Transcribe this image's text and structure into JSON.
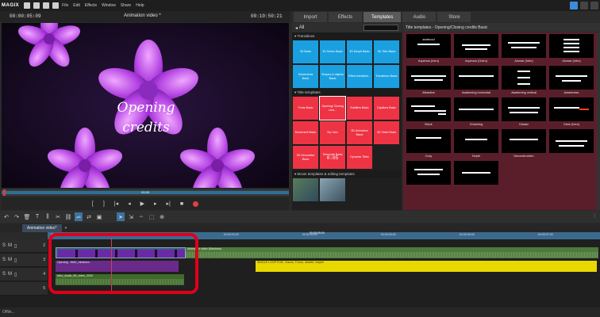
{
  "app": {
    "logo": "MAGIX",
    "menu": [
      "File",
      "Edit",
      "Effects",
      "Window",
      "Share",
      "Help"
    ]
  },
  "preview": {
    "timecode_left": "00:00:05:09",
    "title": "Animation video *",
    "timecode_right": "00:10:50:21",
    "overlay_line1": "Opening",
    "overlay_line2": "credits",
    "scrub_label": "00:05",
    "scrub_progress": 0.01
  },
  "tabs": [
    "Import",
    "Effects",
    "Templates",
    "Audio",
    "Store"
  ],
  "active_tab": "Templates",
  "catalog": {
    "filter_label": "All",
    "sections": [
      {
        "title": "Transitions",
        "tiles": [
          {
            "label": "3D Basic",
            "color": "blue"
          },
          {
            "label": "3D Series Basic",
            "color": "blue"
          },
          {
            "label": "3D Morph Basic",
            "color": "blue"
          },
          {
            "label": "3D Tiles Basic",
            "color": "blue"
          },
          {
            "label": "Movements Basic",
            "color": "blue"
          },
          {
            "label": "Shapes & objects Basic",
            "color": "blue"
          },
          {
            "label": "Effect transition...",
            "color": "blue"
          },
          {
            "label": "Transitions Basic",
            "color": "blue"
          }
        ]
      },
      {
        "title": "Title templates",
        "tiles": [
          {
            "label": "Fonts Basic",
            "color": "red"
          },
          {
            "label": "Opening/ Closing cred...",
            "color": "red"
          },
          {
            "label": "Subtitles Basic",
            "color": "red"
          },
          {
            "label": "Captions Basic",
            "color": "red"
          },
          {
            "label": "Movement Basic",
            "color": "red"
          },
          {
            "label": "My Own",
            "color": "red"
          },
          {
            "label": "3D Animation Basic",
            "color": "red"
          },
          {
            "label": "3D Static Basic",
            "color": "red"
          },
          {
            "label": "3D Decorative Basic",
            "color": "red"
          },
          {
            "label": "Timecode Basic",
            "color": "red"
          },
          {
            "label": "Dynamic Titles",
            "color": "red"
          }
        ]
      },
      {
        "title": "Movie templates & editing templates",
        "tiles": [
          {
            "label": "",
            "color": "photo"
          },
          {
            "label": "",
            "color": "photo"
          }
        ]
      }
    ],
    "timecode_tile_text": "0:05"
  },
  "templates_panel": {
    "title": "Title templates - Opening/Closing credits Basic",
    "items": [
      {
        "label": "Aqueous (Intro)",
        "thumb_text": "andmoul"
      },
      {
        "label": "Aqueous (Outro)",
        "thumb_text": ""
      },
      {
        "label": "Alomar (Intro)",
        "thumb_text": ""
      },
      {
        "label": "Alomar (Intro)",
        "thumb_text": ""
      },
      {
        "label": "Attractive",
        "thumb_text": ""
      },
      {
        "label": "Awakening horizontal",
        "thumb_text": ""
      },
      {
        "label": "Awakening vertical",
        "thumb_text": ""
      },
      {
        "label": "Awareness",
        "thumb_text": ""
      },
      {
        "label": "Block",
        "thumb_text": ""
      },
      {
        "label": "Charming",
        "thumb_text": ""
      },
      {
        "label": "Classic",
        "thumb_text": ""
      },
      {
        "label": "Clear (Intro)",
        "thumb_text": ""
      },
      {
        "label": "Cozy",
        "thumb_text": ""
      },
      {
        "label": "Depth",
        "thumb_text": ""
      },
      {
        "label": "Deconstruction",
        "thumb_text": ""
      },
      {
        "label": "",
        "thumb_text": ""
      },
      {
        "label": "",
        "thumb_text": ""
      },
      {
        "label": "",
        "thumb_text": ""
      }
    ]
  },
  "timeline": {
    "tab_label": "Animation video*",
    "ruler_marks": [
      {
        "label": "00:00",
        "at": 0.0
      },
      {
        "label": "00:00:01:00",
        "at": 0.11
      },
      {
        "label": "00:00:02:00",
        "at": 0.22
      },
      {
        "label": "00:00:03:00",
        "at": 0.33
      },
      {
        "label": "00:00:04:00",
        "at": 0.48
      },
      {
        "label": "00:00:05:00",
        "at": 0.63
      },
      {
        "label": "00:00:06:00",
        "at": 0.78
      },
      {
        "label": "00:00:07:00",
        "at": 0.93
      }
    ],
    "ruler_center": "00:00:05:00",
    "tracks": [
      {
        "mute": "S",
        "solo": "M",
        "num": "2"
      },
      {
        "mute": "S",
        "solo": "M",
        "num": "3"
      },
      {
        "mute": "S",
        "solo": "M",
        "num": "4"
      },
      {
        "mute": "",
        "solo": "",
        "num": "5"
      }
    ],
    "clips": {
      "track2": "Animation video (Mixdown)",
      "track3_purple": "Opening - WAV_mixdown",
      "track3_yellow": "SINGLE LOOP FUN - Kazoo, Ti-boo, ukulele, maybe",
      "track4": "Intro_Audio_56_video_2020"
    },
    "footer": "Offlin..."
  }
}
